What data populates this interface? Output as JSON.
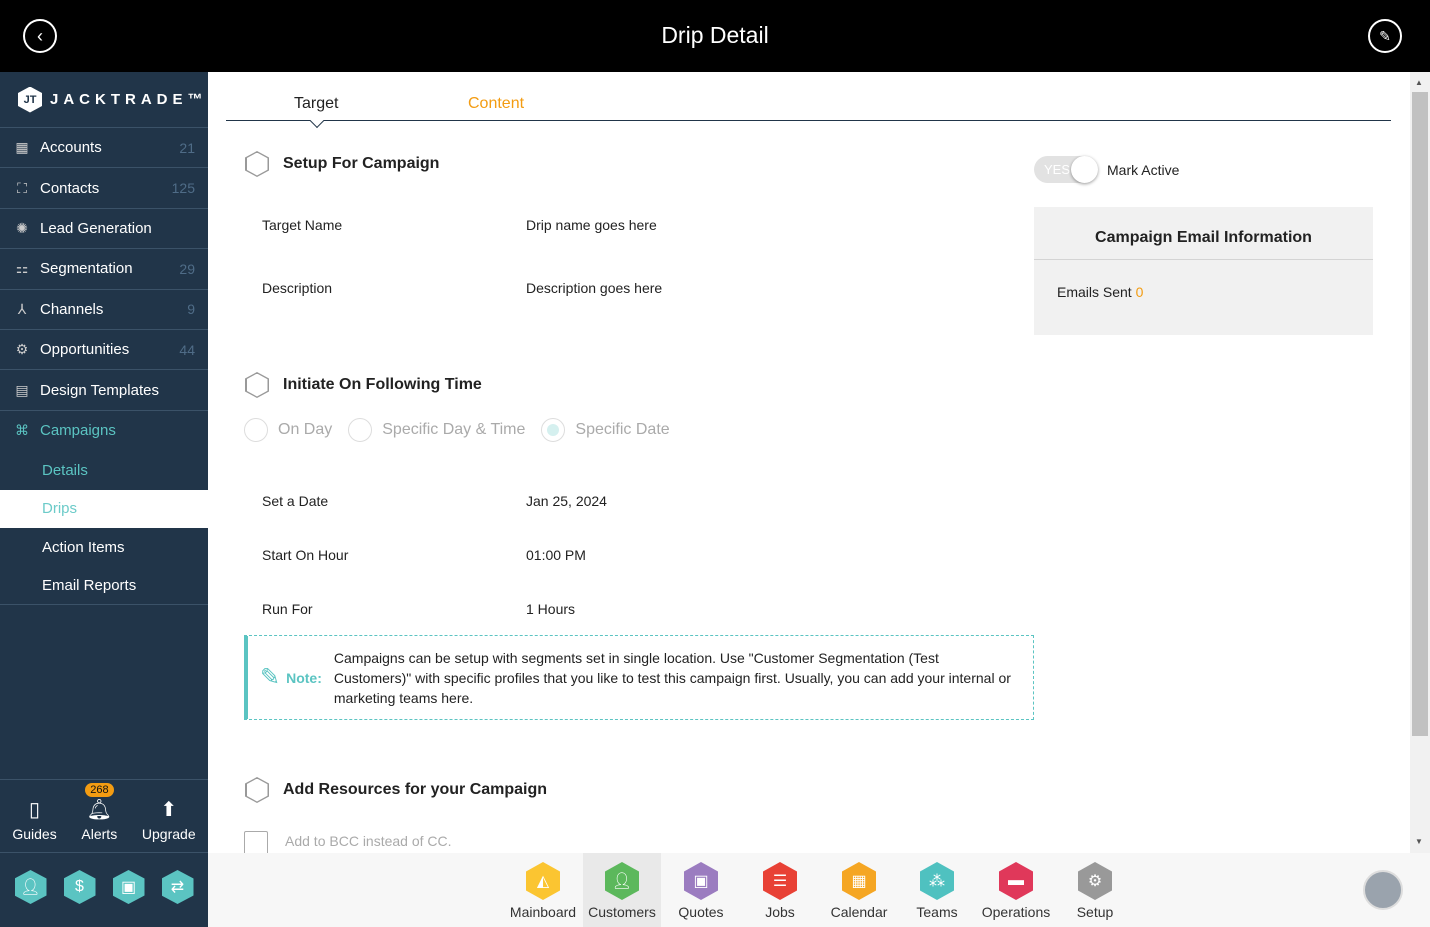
{
  "header": {
    "title": "Drip Detail",
    "back_icon": "chevron-left-icon",
    "edit_icon": "pencil-icon"
  },
  "sidebar": {
    "logo": "JACKTRADE™",
    "items": [
      {
        "label": "Accounts",
        "count": "21",
        "icon": "building-icon"
      },
      {
        "label": "Contacts",
        "count": "125",
        "icon": "contacts-icon"
      },
      {
        "label": "Lead Generation",
        "count": "",
        "icon": "lead-icon"
      },
      {
        "label": "Segmentation",
        "count": "29",
        "icon": "segmentation-icon"
      },
      {
        "label": "Channels",
        "count": "9",
        "icon": "channels-icon"
      },
      {
        "label": "Opportunities",
        "count": "44",
        "icon": "opportunities-icon"
      },
      {
        "label": "Design Templates",
        "count": "",
        "icon": "templates-icon"
      },
      {
        "label": "Campaigns",
        "count": "",
        "icon": "campaigns-icon"
      }
    ],
    "subitems": [
      "Details",
      "Drips",
      "Action Items",
      "Email Reports"
    ],
    "bottom": [
      {
        "label": "Guides"
      },
      {
        "label": "Alerts",
        "badge": "268"
      },
      {
        "label": "Upgrade"
      }
    ]
  },
  "tabs": [
    "Target",
    "Content"
  ],
  "setup": {
    "title": "Setup For Campaign",
    "fields": [
      {
        "label": "Target Name",
        "value": "Drip name goes here"
      },
      {
        "label": "Description",
        "value": "Description goes here"
      }
    ]
  },
  "toggle": {
    "text": "YES",
    "label": "Mark Active",
    "on": true
  },
  "card": {
    "title": "Campaign Email Information",
    "emails_label": "Emails Sent",
    "emails_value": "0"
  },
  "initiate": {
    "title": "Initiate On Following Time",
    "options": [
      "On Day",
      "Specific Day & Time",
      "Specific Date"
    ],
    "selected": "Specific Date",
    "fields": [
      {
        "label": "Set a Date",
        "value": "Jan 25, 2024"
      },
      {
        "label": "Start On Hour",
        "value": "01:00 PM"
      },
      {
        "label": "Run For",
        "value": "1 Hours"
      }
    ]
  },
  "note": {
    "label": "Note:",
    "text": "Campaigns can be setup with segments set in single location. Use \"Customer Segmentation (Test Customers)\" with specific profiles that you like to test this campaign first. Usually, you can add your internal or marketing teams here."
  },
  "resources": {
    "title": "Add Resources for your Campaign",
    "bcc_label": "Add to BCC instead of CC.",
    "bcc_checked": false
  },
  "apps": [
    {
      "label": "Mainboard",
      "color": "#fbc531"
    },
    {
      "label": "Customers",
      "color": "#5cb85c"
    },
    {
      "label": "Quotes",
      "color": "#9b7cc0"
    },
    {
      "label": "Jobs",
      "color": "#e84135"
    },
    {
      "label": "Calendar",
      "color": "#f5a623"
    },
    {
      "label": "Teams",
      "color": "#4fc1c0"
    },
    {
      "label": "Operations",
      "color": "#e0385a"
    },
    {
      "label": "Setup",
      "color": "#999999"
    }
  ],
  "colors": {
    "sidebar": "#213549",
    "accent": "#5bc4c2",
    "orange": "#f39c12"
  }
}
